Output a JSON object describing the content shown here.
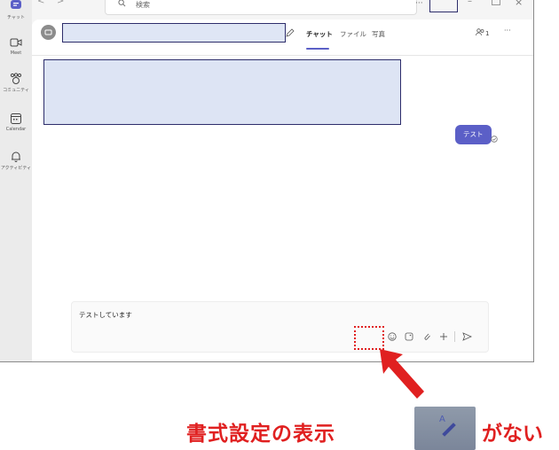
{
  "rail": {
    "items": [
      {
        "label": "チャット",
        "icon": "chat-icon"
      },
      {
        "label": "Meet",
        "icon": "video-camera-icon"
      },
      {
        "label": "コミュニティ",
        "icon": "community-icon"
      },
      {
        "label": "Calendar",
        "icon": "calendar-icon"
      },
      {
        "label": "アクティビティ",
        "icon": "bell-icon"
      }
    ]
  },
  "titlebar": {
    "back": "<",
    "forward": ">",
    "search_placeholder": "検索",
    "more": "···",
    "minimize": "–",
    "close": "×"
  },
  "chat": {
    "tabs": [
      "チャット",
      "ファイル",
      "写真"
    ],
    "active_tab": "チャット",
    "participants_count": "1",
    "more": "···",
    "sent_message": "テスト"
  },
  "compose": {
    "draft_text": "テストしています"
  },
  "annotation": {
    "caption_left": "書式設定の表示",
    "caption_right": "がない",
    "highlight_color": "#e02020"
  },
  "colors": {
    "accent": "#5b5fc7",
    "redaction_border": "#2d2d6b",
    "redaction_fill": "#dde4f4"
  }
}
